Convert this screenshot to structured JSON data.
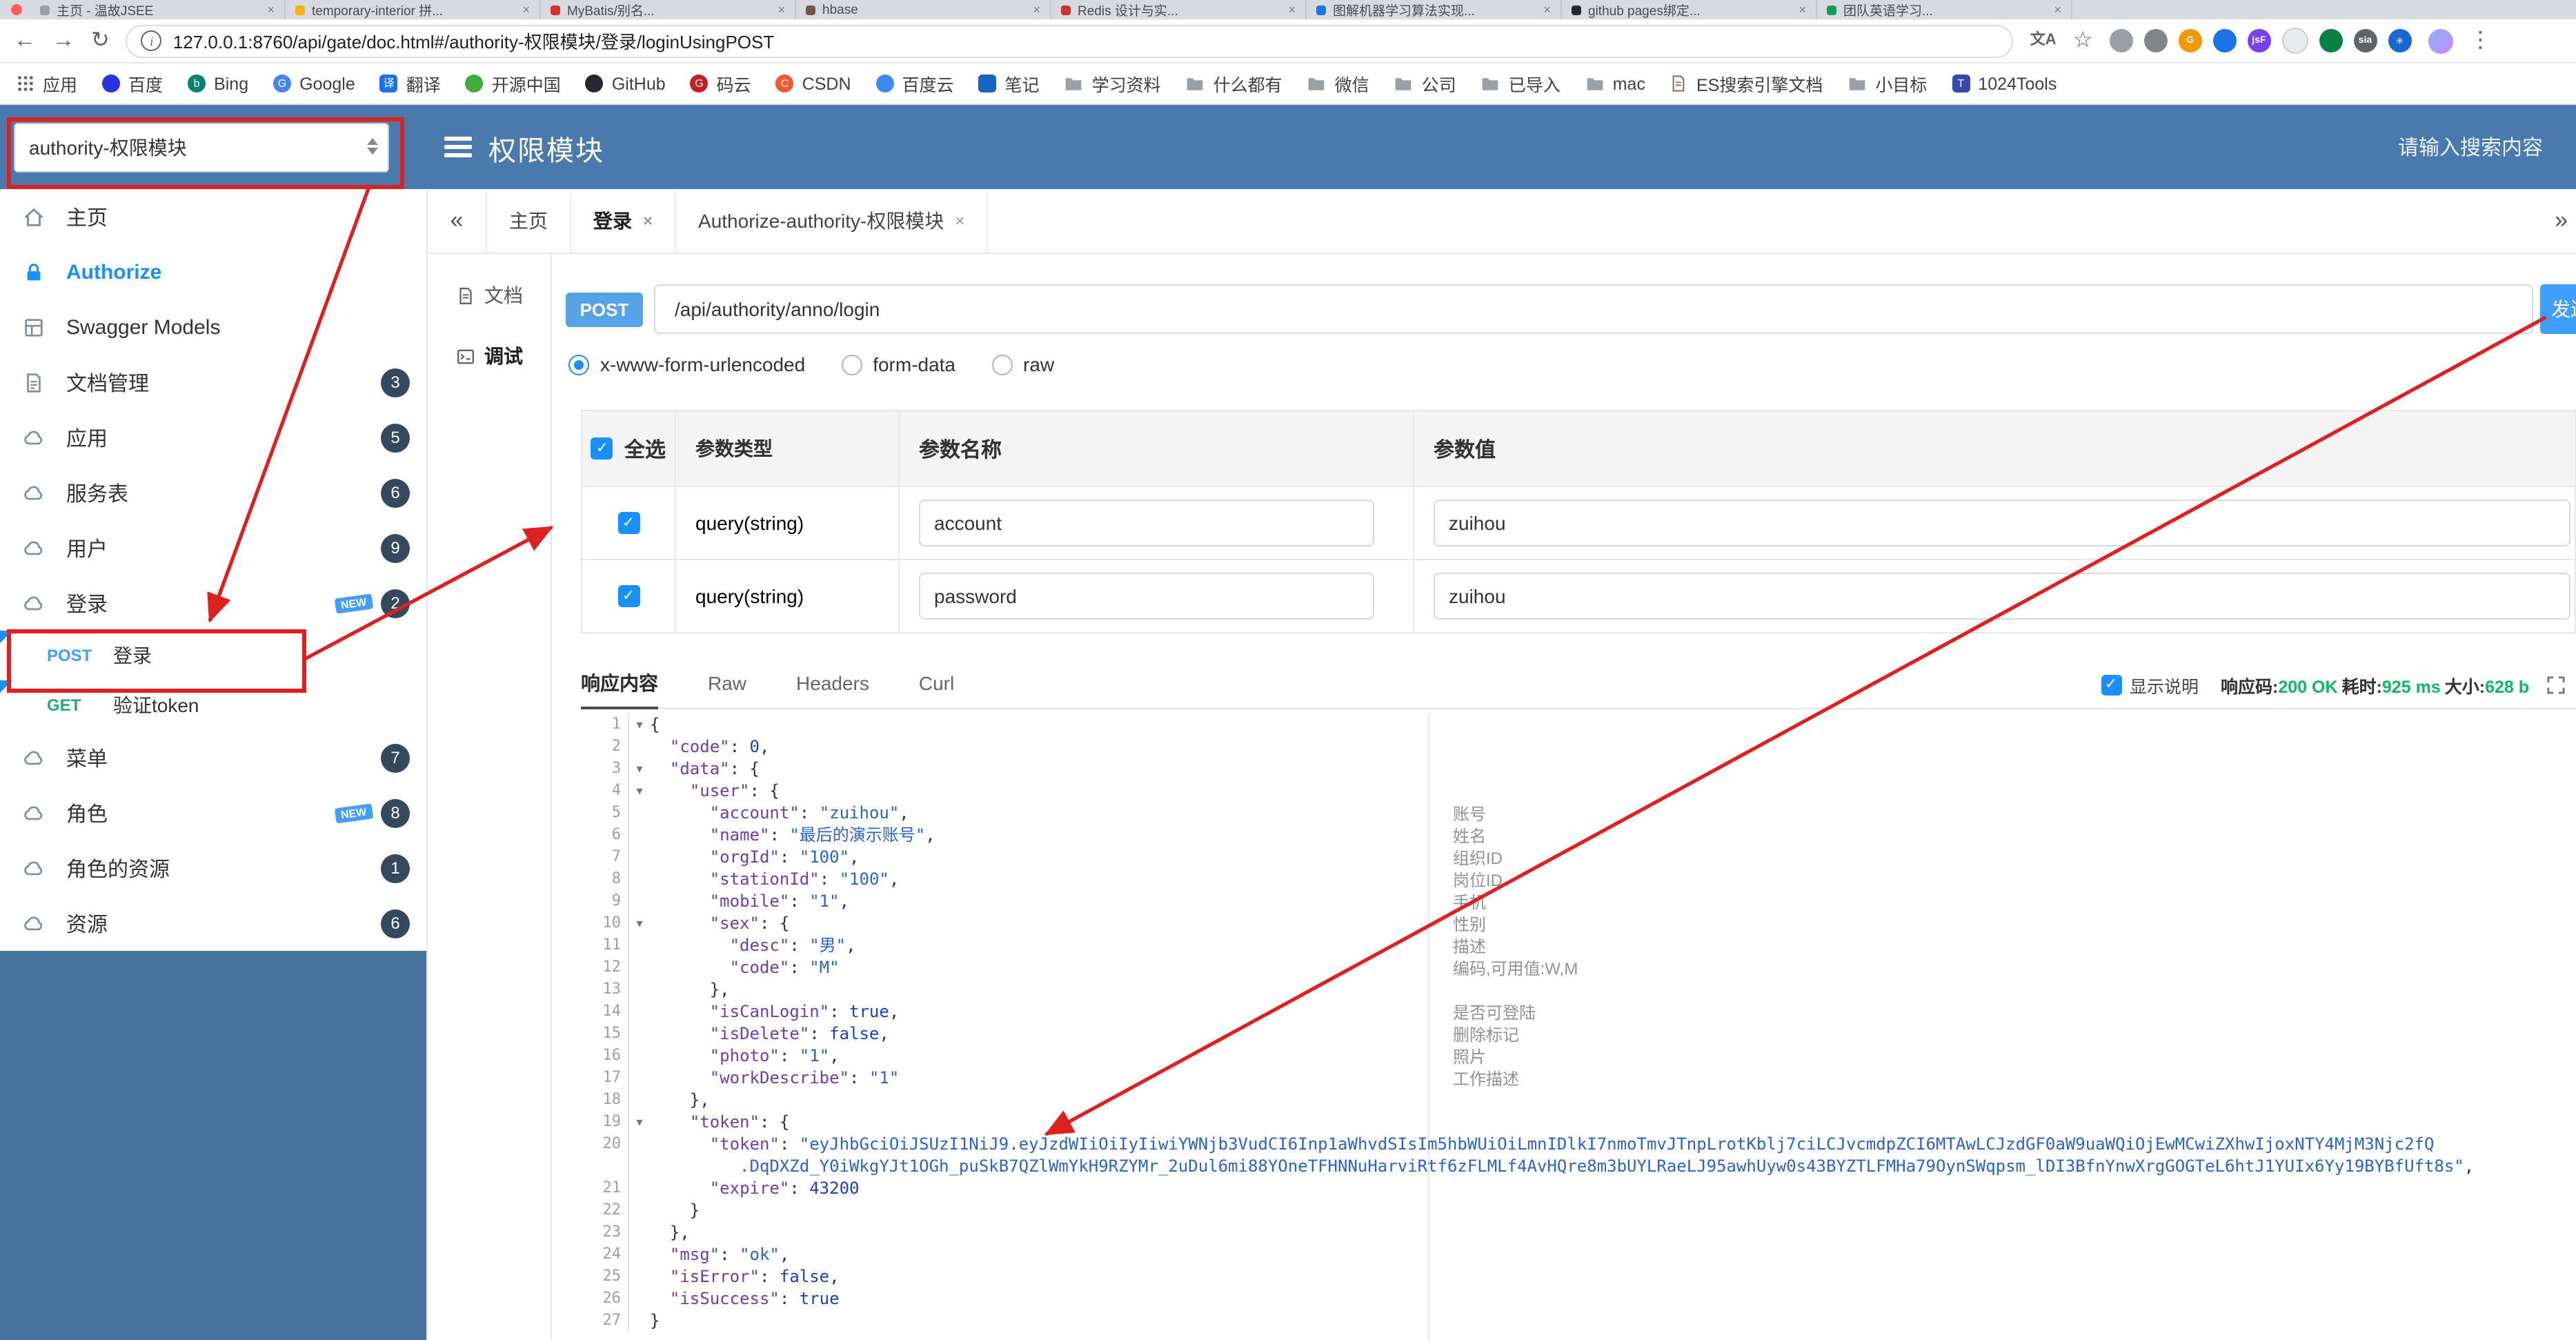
{
  "browser": {
    "window_tabs": [
      {
        "title": "主页 - 温故JSEE",
        "color": "#9aa0a6"
      },
      {
        "title": "temporary-interior 拼...",
        "color": "#f4b400"
      },
      {
        "title": "MyBatis/别名...",
        "color": "#d93025"
      },
      {
        "title": "hbase",
        "color": "#795548"
      },
      {
        "title": "Redis 设计与实...",
        "color": "#d32f2f"
      },
      {
        "title": "图解机器学习算法实现...",
        "color": "#1a73e8"
      },
      {
        "title": "github pages绑定...",
        "color": "#24292e"
      },
      {
        "title": "团队英语学习...",
        "color": "#0f9d58"
      }
    ],
    "toolbar": {
      "url": "127.0.0.1:8760/api/gate/doc.html#/authority-权限模块/登录/loginUsingPOST"
    },
    "extensions": [
      {
        "name": "screenshot-extension-icon",
        "color": "#9aa0a6",
        "glyph": ""
      },
      {
        "name": "gray-extension-icon",
        "color": "#80868b",
        "glyph": ""
      },
      {
        "name": "orange-g-extension-icon",
        "color": "#f29900",
        "glyph": "G"
      },
      {
        "name": "blue-extension-icon",
        "color": "#1a73e8",
        "glyph": ""
      },
      {
        "name": "jsf-extension-icon",
        "color": "#7b3ff2",
        "glyph": "jsF"
      },
      {
        "name": "white-extension-icon",
        "color": "#e8eaed",
        "glyph": ""
      },
      {
        "name": "shield-extension-icon",
        "color": "#0b8043",
        "glyph": ""
      },
      {
        "name": "sia-extension-icon",
        "color": "#5f6368",
        "glyph": "sia"
      },
      {
        "name": "asterisk-extension-icon",
        "color": "#1967d2",
        "glyph": "✳"
      }
    ],
    "bookmarks": [
      {
        "label": "应用",
        "icon": "apps-grid-icon",
        "shape": "apps"
      },
      {
        "label": "百度",
        "icon": "baidu-icon",
        "shape": "dot",
        "color": "#2932e1"
      },
      {
        "label": "Bing",
        "icon": "bing-icon",
        "shape": "dot",
        "color": "#008373",
        "letter": "b"
      },
      {
        "label": "Google",
        "icon": "google-icon",
        "shape": "dot",
        "color": "#4285f4",
        "letter": "G"
      },
      {
        "label": "翻译",
        "icon": "translate-icon",
        "shape": "square",
        "color": "#1a73e8",
        "letter": "译"
      },
      {
        "label": "开源中国",
        "icon": "oschina-icon",
        "shape": "dot",
        "color": "#41ae3c"
      },
      {
        "label": "GitHub",
        "icon": "github-icon",
        "shape": "dot",
        "color": "#24292e"
      },
      {
        "label": "码云",
        "icon": "gitee-icon",
        "shape": "dot",
        "color": "#c71d23",
        "letter": "G"
      },
      {
        "label": "CSDN",
        "icon": "csdn-icon",
        "shape": "dot",
        "color": "#fc5531",
        "letter": "C"
      },
      {
        "label": "百度云",
        "icon": "baiduyun-icon",
        "shape": "dot",
        "color": "#3d8af0"
      },
      {
        "label": "笔记",
        "icon": "note-icon",
        "shape": "square",
        "color": "#1565c0"
      },
      {
        "label": "学习资料",
        "icon": "folder-icon",
        "shape": "folder"
      },
      {
        "label": "什么都有",
        "icon": "folder-icon",
        "shape": "folder"
      },
      {
        "label": "微信",
        "icon": "folder-icon",
        "shape": "folder"
      },
      {
        "label": "公司",
        "icon": "folder-icon",
        "shape": "folder"
      },
      {
        "label": "已导入",
        "icon": "folder-icon",
        "shape": "folder"
      },
      {
        "label": "mac",
        "icon": "folder-icon",
        "shape": "folder"
      },
      {
        "label": "ES搜索引擎文档",
        "icon": "es-doc-icon",
        "shape": "doc"
      },
      {
        "label": "小目标",
        "icon": "folder-icon",
        "shape": "folder"
      },
      {
        "label": "1024Tools",
        "icon": "tools-icon",
        "shape": "square",
        "color": "#3949ab",
        "letter": "T"
      }
    ]
  },
  "app": {
    "header": {
      "project_select_value": "authority-权限模块",
      "title": "权限模块",
      "search_placeholder": "请输入搜索内容"
    },
    "sidebar": {
      "items": [
        {
          "key": "home",
          "label": "主页",
          "icon": "home"
        },
        {
          "key": "authorize",
          "label": "Authorize",
          "icon": "lock",
          "accent": true
        },
        {
          "key": "swagger-models",
          "label": "Swagger Models",
          "icon": "models"
        },
        {
          "key": "docs",
          "label": "文档管理",
          "icon": "doc",
          "badge": "3"
        },
        {
          "key": "application",
          "label": "应用",
          "icon": "cloud",
          "badge": "5"
        },
        {
          "key": "service",
          "label": "服务表",
          "icon": "cloud",
          "badge": "6"
        },
        {
          "key": "user",
          "label": "用户",
          "icon": "cloud",
          "badge": "9"
        },
        {
          "key": "login",
          "label": "登录",
          "icon": "cloud",
          "badge": "2",
          "new": true,
          "expand_children": true
        },
        {
          "key": "menu",
          "label": "菜单",
          "icon": "cloud",
          "badge": "7"
        },
        {
          "key": "role",
          "label": "角色",
          "icon": "cloud",
          "badge": "8",
          "new": true
        },
        {
          "key": "role-resource",
          "label": "角色的资源",
          "icon": "cloud",
          "badge": "1"
        },
        {
          "key": "resource",
          "label": "资源",
          "icon": "cloud",
          "badge": "6"
        }
      ],
      "api_items": [
        {
          "method": "POST",
          "label": "登录",
          "active": true
        },
        {
          "method": "GET",
          "label": "验证token",
          "active": false
        }
      ]
    },
    "content_tabs": {
      "collapse_icon": "«",
      "more_icon": "»",
      "tabs": [
        {
          "label": "主页",
          "closable": false,
          "active": false
        },
        {
          "label": "登录",
          "closable": true,
          "active": true
        },
        {
          "label": "Authorize-authority-权限模块",
          "closable": true,
          "active": false
        }
      ]
    },
    "side_nav": [
      {
        "label": "文档",
        "icon": "doc",
        "active": false
      },
      {
        "label": "调试",
        "icon": "debug",
        "active": true
      }
    ],
    "debug": {
      "method": "POST",
      "path": "/api/authority/anno/login",
      "send_label": "发送",
      "content_types": [
        {
          "label": "x-www-form-urlencoded",
          "checked": true
        },
        {
          "label": "form-data",
          "checked": false
        },
        {
          "label": "raw",
          "checked": false
        }
      ],
      "table": {
        "headers": [
          "全选",
          "参数类型",
          "参数名称",
          "参数值"
        ],
        "rows": [
          {
            "checked": true,
            "type": "query(string)",
            "name": "account",
            "value": "zuihou"
          },
          {
            "checked": true,
            "type": "query(string)",
            "name": "password",
            "value": "zuihou"
          }
        ]
      },
      "response": {
        "tabs": [
          {
            "label": "响应内容",
            "active": true
          },
          {
            "label": "Raw",
            "active": false
          },
          {
            "label": "Headers",
            "active": false
          },
          {
            "label": "Curl",
            "active": false
          }
        ],
        "show_desc_label": "显示说明",
        "stats": [
          {
            "label": "响应码:",
            "value": "200 OK"
          },
          {
            "label": "耗时:",
            "value": "925 ms"
          },
          {
            "label": "大小:",
            "value": "628 b"
          }
        ]
      },
      "code_lines": [
        {
          "f": 1,
          "s": [
            [
              "p",
              "{"
            ]
          ]
        },
        {
          "s": [
            [
              "p",
              "  "
            ],
            [
              "k",
              "\"code\""
            ],
            [
              "p",
              ": "
            ],
            [
              "n",
              "0"
            ],
            [
              "p",
              ","
            ]
          ]
        },
        {
          "f": 1,
          "s": [
            [
              "p",
              "  "
            ],
            [
              "k",
              "\"data\""
            ],
            [
              "p",
              ": {"
            ]
          ]
        },
        {
          "f": 1,
          "s": [
            [
              "p",
              "    "
            ],
            [
              "k",
              "\"user\""
            ],
            [
              "p",
              ": {"
            ]
          ]
        },
        {
          "s": [
            [
              "p",
              "      "
            ],
            [
              "k",
              "\"account\""
            ],
            [
              "p",
              ": "
            ],
            [
              "s",
              "\"zuihou\""
            ],
            [
              "p",
              ","
            ]
          ]
        },
        {
          "s": [
            [
              "p",
              "      "
            ],
            [
              "k",
              "\"name\""
            ],
            [
              "p",
              ": "
            ],
            [
              "s",
              "\"最后的演示账号\""
            ],
            [
              "p",
              ","
            ]
          ]
        },
        {
          "s": [
            [
              "p",
              "      "
            ],
            [
              "k",
              "\"orgId\""
            ],
            [
              "p",
              ": "
            ],
            [
              "s",
              "\"100\""
            ],
            [
              "p",
              ","
            ]
          ]
        },
        {
          "s": [
            [
              "p",
              "      "
            ],
            [
              "k",
              "\"stationId\""
            ],
            [
              "p",
              ": "
            ],
            [
              "s",
              "\"100\""
            ],
            [
              "p",
              ","
            ]
          ]
        },
        {
          "s": [
            [
              "p",
              "      "
            ],
            [
              "k",
              "\"mobile\""
            ],
            [
              "p",
              ": "
            ],
            [
              "s",
              "\"1\""
            ],
            [
              "p",
              ","
            ]
          ]
        },
        {
          "f": 1,
          "s": [
            [
              "p",
              "      "
            ],
            [
              "k",
              "\"sex\""
            ],
            [
              "p",
              ": {"
            ]
          ]
        },
        {
          "s": [
            [
              "p",
              "        "
            ],
            [
              "k",
              "\"desc\""
            ],
            [
              "p",
              ": "
            ],
            [
              "s",
              "\"男\""
            ],
            [
              "p",
              ","
            ]
          ]
        },
        {
          "s": [
            [
              "p",
              "        "
            ],
            [
              "k",
              "\"code\""
            ],
            [
              "p",
              ": "
            ],
            [
              "s",
              "\"M\""
            ]
          ]
        },
        {
          "s": [
            [
              "p",
              "      },"
            ]
          ]
        },
        {
          "s": [
            [
              "p",
              "      "
            ],
            [
              "k",
              "\"isCanLogin\""
            ],
            [
              "p",
              ": "
            ],
            [
              "b",
              "true"
            ],
            [
              "p",
              ","
            ]
          ]
        },
        {
          "s": [
            [
              "p",
              "      "
            ],
            [
              "k",
              "\"isDelete\""
            ],
            [
              "p",
              ": "
            ],
            [
              "b",
              "false"
            ],
            [
              "p",
              ","
            ]
          ]
        },
        {
          "s": [
            [
              "p",
              "      "
            ],
            [
              "k",
              "\"photo\""
            ],
            [
              "p",
              ": "
            ],
            [
              "s",
              "\"1\""
            ],
            [
              "p",
              ","
            ]
          ]
        },
        {
          "s": [
            [
              "p",
              "      "
            ],
            [
              "k",
              "\"workDescribe\""
            ],
            [
              "p",
              ": "
            ],
            [
              "s",
              "\"1\""
            ]
          ]
        },
        {
          "s": [
            [
              "p",
              "    },"
            ]
          ]
        },
        {
          "f": 1,
          "s": [
            [
              "p",
              "    "
            ],
            [
              "k",
              "\"token\""
            ],
            [
              "p",
              ": {"
            ]
          ]
        },
        {
          "s": [
            [
              "p",
              "      "
            ],
            [
              "k",
              "\"token\""
            ],
            [
              "p",
              ": "
            ],
            [
              "s",
              "\"eyJhbGciOiJSUzI1NiJ9.eyJzdWIiOiIyIiwiYWNjb3VudCI6Inp1aWhvdSIsIm5hbWUiOiLmnIDlkI7nmoTmvJTnpLrotKblj7ciLCJvcmdpZCI6MTAwLCJzdGF0aW9uaWQiOjEwMCwiZXhwIjoxNTY4MjM3Njc2fQ"
            ]
          ],
          "w": [
            [
              "s",
              "         .DqDXZd_Y0iWkgYJt1OGh_puSkB7QZlWmYkH9RZYMr_2uDul6mi88YOneTFHNNuHarviRtf6zFLMLf4AvHQre8m3bUYLRaeLJ95awhUyw0s43BYZTLFMHa79OynSWqpsm_lDI3BfnYnwXrgGOGTeL6htJ1YUIx6Yy19BYBfUft8s\""
            ],
            [
              "p",
              ","
            ]
          ]
        },
        {
          "s": [
            [
              "p",
              "      "
            ],
            [
              "k",
              "\"expire\""
            ],
            [
              "p",
              ": "
            ],
            [
              "n",
              "43200"
            ]
          ]
        },
        {
          "s": [
            [
              "p",
              "    }"
            ]
          ]
        },
        {
          "s": [
            [
              "p",
              "  },"
            ]
          ]
        },
        {
          "s": [
            [
              "p",
              "  "
            ],
            [
              "k",
              "\"msg\""
            ],
            [
              "p",
              ": "
            ],
            [
              "s",
              "\"ok\""
            ],
            [
              "p",
              ","
            ]
          ]
        },
        {
          "s": [
            [
              "p",
              "  "
            ],
            [
              "k",
              "\"isError\""
            ],
            [
              "p",
              ": "
            ],
            [
              "b",
              "false"
            ],
            [
              "p",
              ","
            ]
          ]
        },
        {
          "s": [
            [
              "p",
              "  "
            ],
            [
              "k",
              "\"isSuccess\""
            ],
            [
              "p",
              ": "
            ],
            [
              "b",
              "true"
            ]
          ]
        },
        {
          "s": [
            [
              "p",
              "}"
            ]
          ]
        }
      ],
      "field_notes": [
        {
          "line": 5,
          "text": "账号"
        },
        {
          "line": 6,
          "text": "姓名"
        },
        {
          "line": 7,
          "text": "组织ID"
        },
        {
          "line": 8,
          "text": "岗位ID"
        },
        {
          "line": 9,
          "text": "手机"
        },
        {
          "line": 10,
          "text": "性别"
        },
        {
          "line": 11,
          "text": "描述"
        },
        {
          "line": 12,
          "text": "编码,可用值:W,M"
        },
        {
          "line": 14,
          "text": "是否可登陆"
        },
        {
          "line": 15,
          "text": "删除标记"
        },
        {
          "line": 16,
          "text": "照片"
        },
        {
          "line": 17,
          "text": "工作描述"
        }
      ]
    }
  },
  "colors": {
    "header_blue": "#4a7aad",
    "sidebar_fill_blue": "#46749f",
    "accent_blue": "#1890ff",
    "method_post_badge": "#57a3e8",
    "send_button_blue": "#409eff",
    "badge_dark": "#34495e",
    "success_green": "#0abb61",
    "annotation_red": "#e01f1f",
    "code_key": "#6a3fb5",
    "code_string": "#2962d9",
    "code_number": "#1c41c7"
  }
}
